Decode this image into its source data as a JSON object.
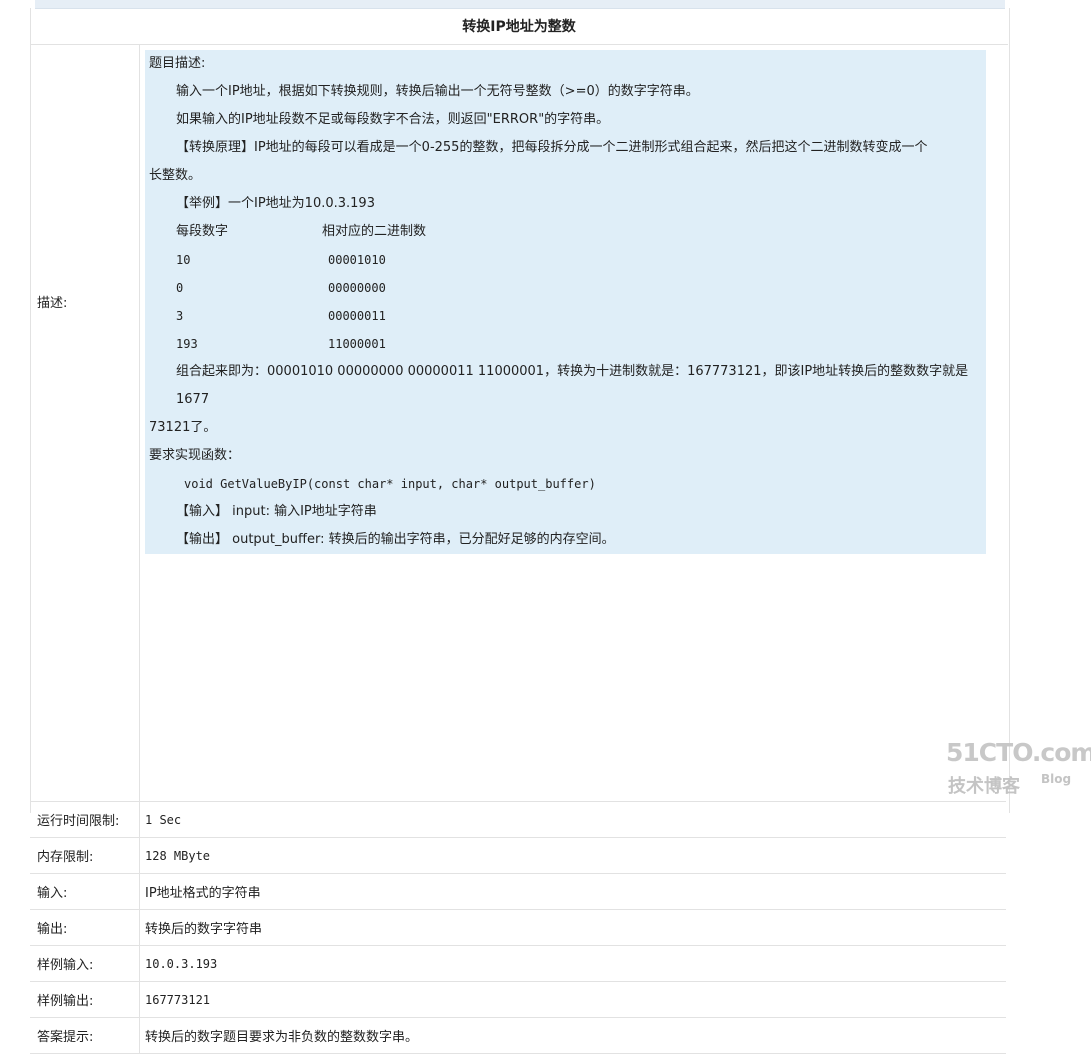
{
  "title": "转换IP地址为整数",
  "description": {
    "label": "描述:",
    "heading": "题目描述:",
    "para1": "输入一个IP地址，根据如下转换规则，转换后输出一个无符号整数（>=0）的数字字符串。",
    "para2": "如果输入的IP地址段数不足或每段数字不合法，则返回\"ERROR\"的字符串。",
    "principle_line1": "【转换原理】IP地址的每段可以看成是一个0-255的整数，把每段拆分成一个二进制形式组合起来，然后把这个二进制数转变成一个",
    "principle_line2": "长整数。",
    "example": "【举例】一个IP地址为10.0.3.193",
    "table_header": {
      "col1": "每段数字",
      "col2": "相对应的二进制数"
    },
    "table_rows": [
      {
        "num": "10",
        "bin": "00001010"
      },
      {
        "num": "0",
        "bin": "00000000"
      },
      {
        "num": "3",
        "bin": "00000011"
      },
      {
        "num": "193",
        "bin": "11000001"
      }
    ],
    "combined_line1": "组合起来即为：00001010 00000000 00000011 11000001，转换为十进制数就是：167773121，即该IP地址转换后的整数数字就是1677",
    "combined_line2": "73121了。",
    "require": "要求实现函数：",
    "func_sig": "void GetValueByIP(const char* input, char* output_buffer)",
    "input_desc": "【输入】 input: 输入IP地址字符串",
    "output_desc": "【输出】 output_buffer: 转换后的输出字符串，已分配好足够的内存空间。"
  },
  "rows": [
    {
      "label": "运行时间限制:",
      "value": "1 Sec"
    },
    {
      "label": "内存限制:",
      "value": "128 MByte"
    },
    {
      "label": "输入:",
      "value": "IP地址格式的字符串"
    },
    {
      "label": "输出:",
      "value": "转换后的数字字符串"
    },
    {
      "label": "样例输入:",
      "value": "10.0.3.193"
    },
    {
      "label": "样例输出:",
      "value": "167773121"
    },
    {
      "label": "答案提示:",
      "value": "转换后的数字题目要求为非负数的整数数字串。"
    }
  ],
  "watermark": {
    "site": "51CTO.com",
    "sub": "技术博客",
    "blog": "Blog"
  }
}
